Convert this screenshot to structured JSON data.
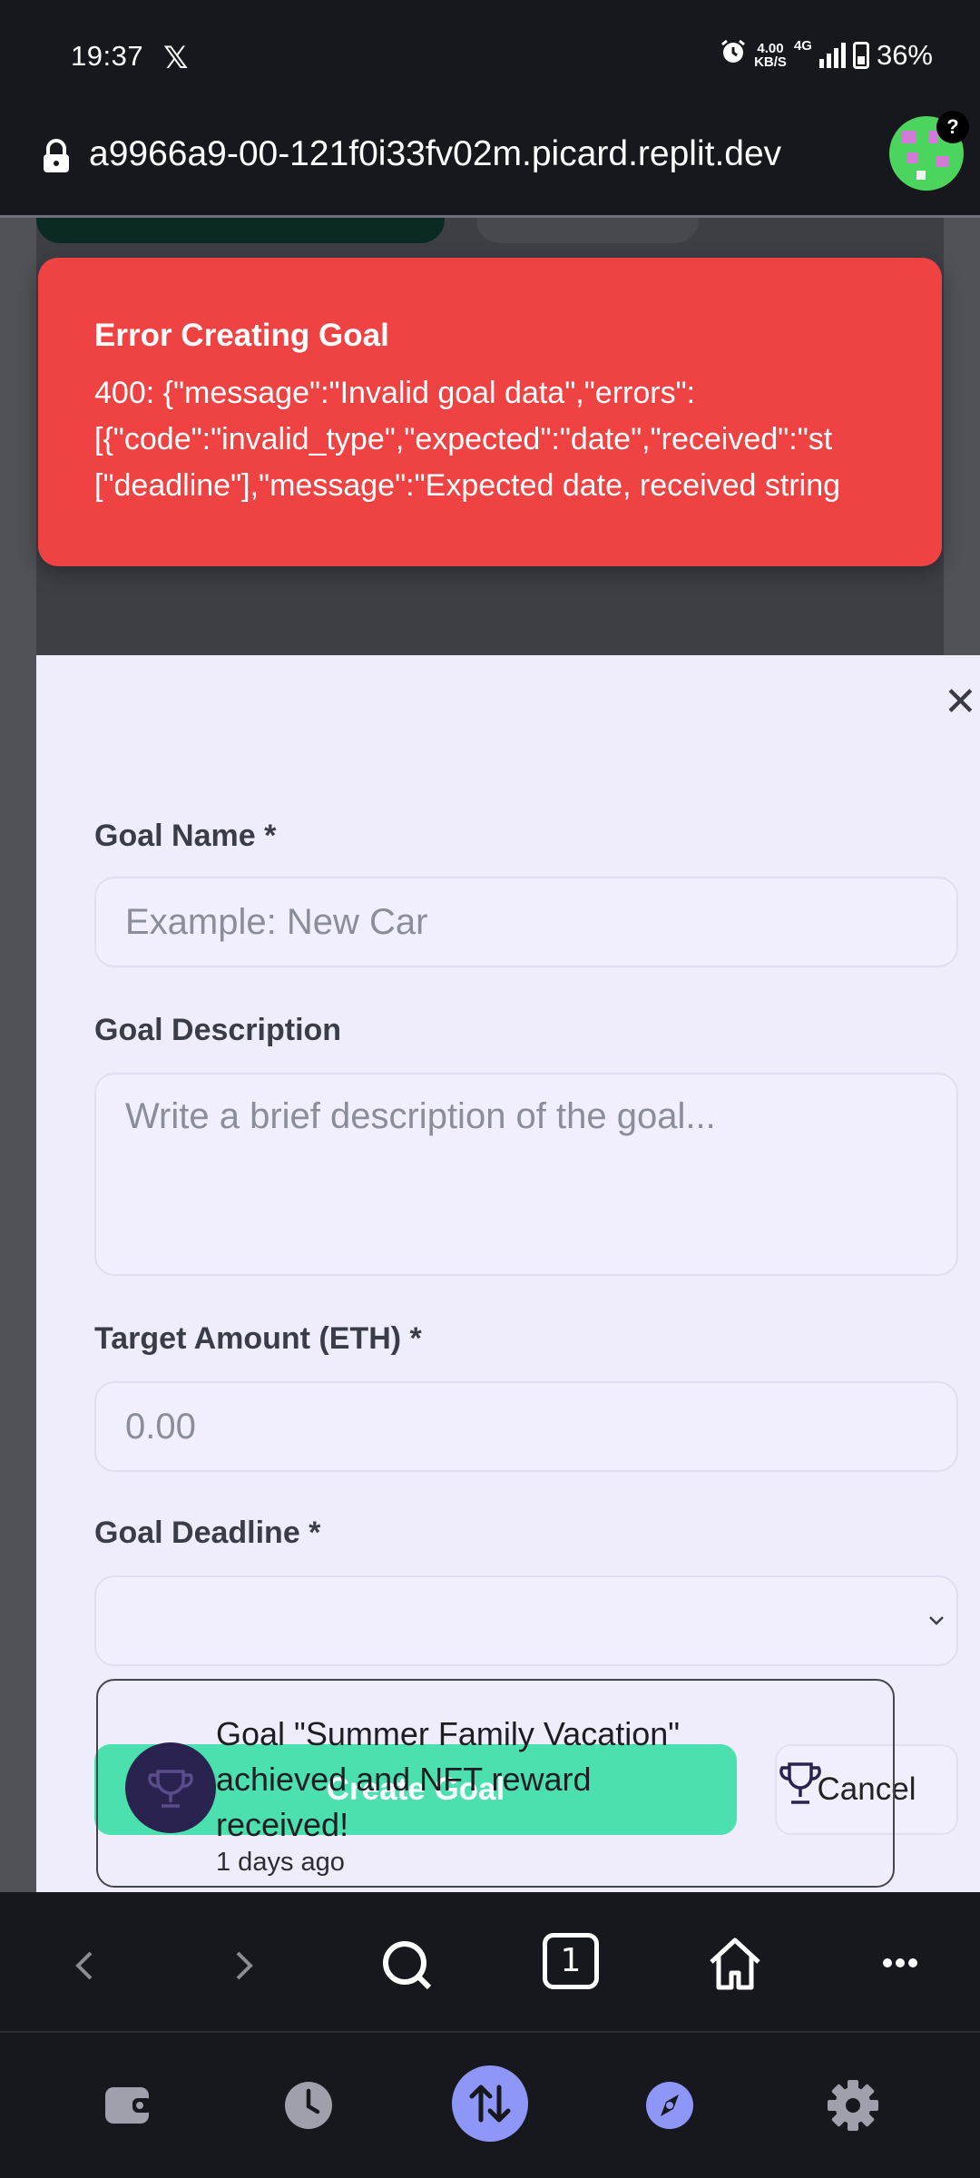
{
  "status_bar": {
    "time": "19:37",
    "app_icon": "x-logo",
    "network_speed": "4.00",
    "network_unit": "KB/S",
    "network_type": "4G",
    "battery": "36%"
  },
  "browser": {
    "url": "a9966a9-00-121f0i33fv02m.picard.replit.dev",
    "avatar_badge": "?",
    "tab_count": "1"
  },
  "toast": {
    "title": "Error Creating Goal",
    "line1": "400: {\"message\":\"Invalid goal data\",\"errors\":",
    "line2": "[{\"code\":\"invalid_type\",\"expected\":\"date\",\"received\":\"st",
    "line3": "[\"deadline\"],\"message\":\"Expected date, received string"
  },
  "form": {
    "goal_name_label": "Goal Name *",
    "goal_name_placeholder": "Example: New Car",
    "goal_description_label": "Goal Description",
    "goal_description_placeholder": "Write a brief description of the goal...",
    "target_amount_label": "Target Amount (ETH) *",
    "target_amount_placeholder": "0.00",
    "goal_deadline_label": "Goal Deadline *",
    "goal_deadline_value": "",
    "create_label": "Create Goal",
    "cancel_label": "Cancel"
  },
  "notification": {
    "text": "Goal \"Summer Family Vacation\" achieved and NFT reward received!",
    "time_ago": "1 days ago"
  },
  "colors": {
    "toast_bg": "#ef4343",
    "create_button": "#4be0ae",
    "modal_bg": "#efedfb",
    "nav_accent": "#8e97f8"
  }
}
